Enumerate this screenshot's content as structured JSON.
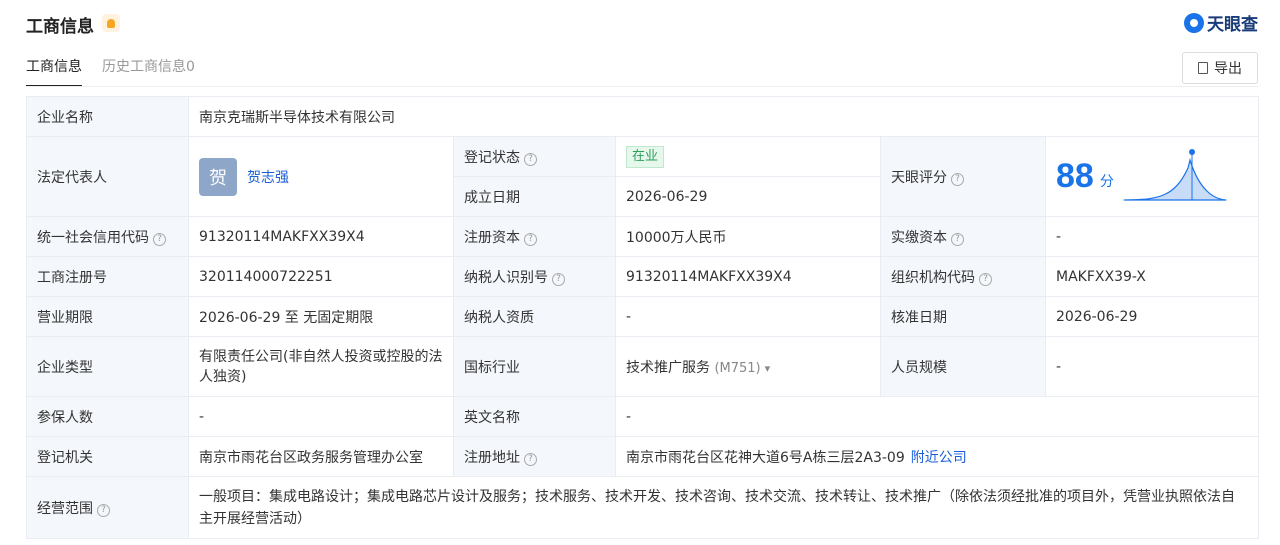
{
  "header": {
    "title": "工商信息",
    "logo_text": "天眼查"
  },
  "tabs": {
    "active": "工商信息",
    "history": "历史工商信息0"
  },
  "toolbar": {
    "export_label": "导出"
  },
  "fields": {
    "company_name": {
      "label": "企业名称",
      "value": "南京克瑞斯半导体技术有限公司"
    },
    "legal_rep": {
      "label": "法定代表人",
      "avatar_char": "贺",
      "name": "贺志强"
    },
    "reg_status": {
      "label": "登记状态",
      "value": "在业"
    },
    "found_date": {
      "label": "成立日期",
      "value": "2026-06-29"
    },
    "tianyan_score": {
      "label": "天眼评分",
      "value": "88",
      "unit": "分"
    },
    "credit_code": {
      "label": "统一社会信用代码",
      "value": "91320114MAKFXX39X4"
    },
    "reg_capital": {
      "label": "注册资本",
      "value": "10000万人民币"
    },
    "paid_capital": {
      "label": "实缴资本",
      "value": "-"
    },
    "reg_number": {
      "label": "工商注册号",
      "value": "320114000722251"
    },
    "taxpayer_id": {
      "label": "纳税人识别号",
      "value": "91320114MAKFXX39X4"
    },
    "org_code": {
      "label": "组织机构代码",
      "value": "MAKFXX39-X"
    },
    "business_term": {
      "label": "营业期限",
      "value": "2026-06-29 至 无固定期限"
    },
    "taxpayer_qual": {
      "label": "纳税人资质",
      "value": "-"
    },
    "approval_date": {
      "label": "核准日期",
      "value": "2026-06-29"
    },
    "company_type": {
      "label": "企业类型",
      "value": "有限责任公司(非自然人投资或控股的法人独资)"
    },
    "industry": {
      "label": "国标行业",
      "value": "技术推广服务",
      "code": "(M751)"
    },
    "staff_size": {
      "label": "人员规模",
      "value": "-"
    },
    "insured_count": {
      "label": "参保人数",
      "value": "-"
    },
    "english_name": {
      "label": "英文名称",
      "value": "-"
    },
    "reg_authority": {
      "label": "登记机关",
      "value": "南京市雨花台区政务服务管理办公室"
    },
    "reg_address": {
      "label": "注册地址",
      "value": "南京市雨花台区花神大道6号A栋三层2A3-09",
      "nearby": "附近公司"
    },
    "business_scope": {
      "label": "经营范围",
      "value": "一般项目：集成电路设计；集成电路芯片设计及服务；技术服务、技术开发、技术咨询、技术交流、技术转让、技术推广（除依法须经批准的项目外，凭营业执照依法自主开展经营活动）"
    }
  },
  "colors": {
    "accent": "#1a73e8",
    "label_bg": "#f4f7fb",
    "status_green": "#2e9e5b"
  },
  "icons": [
    "bell-icon",
    "tianyancha-logo-icon",
    "export-icon",
    "help-icon",
    "chevron-down-icon"
  ]
}
